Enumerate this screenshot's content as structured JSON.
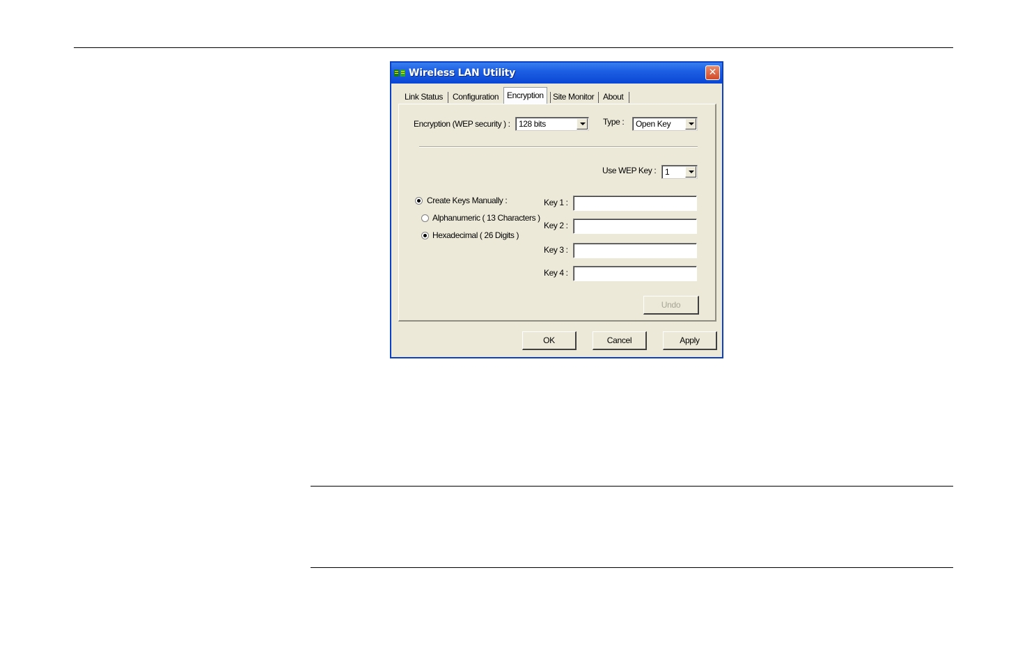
{
  "window": {
    "title": "Wireless LAN Utility",
    "close_glyph": "✕",
    "title_bar_color": "#0a46d4",
    "close_button_color": "#d14b28"
  },
  "tabs": [
    {
      "label": "Link Status",
      "active": false
    },
    {
      "label": "Configuration",
      "active": false
    },
    {
      "label": "Encryption",
      "active": true
    },
    {
      "label": "Site Monitor",
      "active": false
    },
    {
      "label": "About",
      "active": false
    }
  ],
  "encryption": {
    "label": "Encryption (WEP security ) :",
    "value": "128 bits",
    "type_label": "Type :",
    "type_value": "Open Key",
    "use_wep_key_label": "Use WEP Key :",
    "use_wep_key_value": "1"
  },
  "key_creation": {
    "manual_label": "Create Keys Manually :",
    "manual_selected": true,
    "alphanumeric_label": "Alphanumeric ( 13 Characters )",
    "alphanumeric_selected": false,
    "hexadecimal_label": "Hexadecimal ( 26 Digits )",
    "hexadecimal_selected": true
  },
  "keys": [
    {
      "label": "Key 1 :",
      "value": ""
    },
    {
      "label": "Key 2 :",
      "value": ""
    },
    {
      "label": "Key 3 :",
      "value": ""
    },
    {
      "label": "Key 4 :",
      "value": ""
    }
  ],
  "buttons": {
    "undo": "Undo",
    "ok": "OK",
    "cancel": "Cancel",
    "apply": "Apply"
  }
}
